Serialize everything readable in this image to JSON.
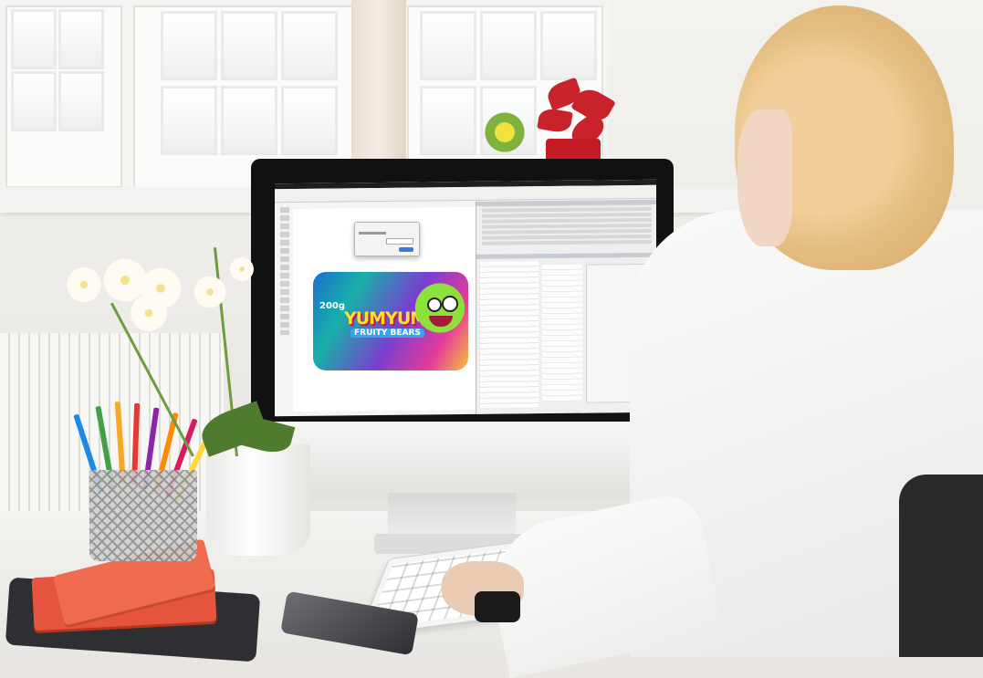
{
  "scene": {
    "description_tag": "office-desk-with-imac",
    "colors": {
      "wall": "#efeeea",
      "desk": "#eeeeec",
      "screen_bg": "#f4f4f4",
      "label_yellow": "#ffe02e",
      "label_pink": "#e43a9b",
      "book_red": "#e5553d"
    }
  },
  "packaging_label": {
    "brand": "YUMYUM",
    "subtitle": "FRUITY BEARS",
    "weight": "200g"
  }
}
